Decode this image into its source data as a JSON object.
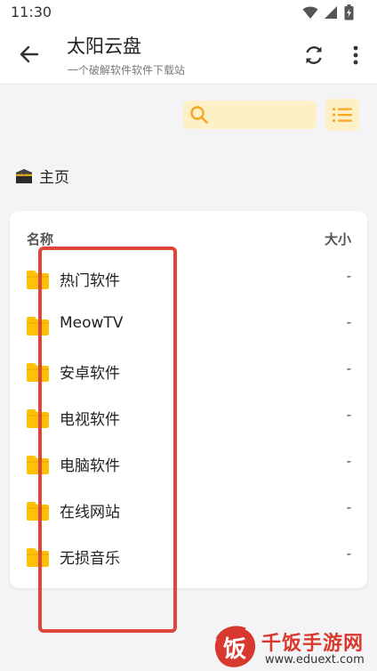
{
  "status_bar": {
    "time": "11:30"
  },
  "app_bar": {
    "title": "太阳云盘",
    "subtitle": "一个破解软件软件下载站"
  },
  "search": {
    "placeholder": "",
    "value": ""
  },
  "breadcrumb": {
    "icon": "kaaba-emoji",
    "emoji": "🕋",
    "label": "主页"
  },
  "table": {
    "headers": {
      "name": "名称",
      "size": "大小"
    },
    "rows": [
      {
        "name": "热门软件",
        "size": "-"
      },
      {
        "name": "MeowTV",
        "size": "-"
      },
      {
        "name": "安卓软件",
        "size": "-"
      },
      {
        "name": "电视软件",
        "size": "-"
      },
      {
        "name": "电脑软件",
        "size": "-"
      },
      {
        "name": "在线网站",
        "size": "-"
      },
      {
        "name": "无损音乐",
        "size": "-"
      }
    ]
  },
  "colors": {
    "accent_light": "#fdefc6",
    "accent": "#f6a623",
    "folder": "#ffc107",
    "annotation": "#e0453a"
  },
  "watermark": {
    "logo_char": "饭",
    "title": "千饭手游网",
    "url": "www.eduext.com"
  }
}
